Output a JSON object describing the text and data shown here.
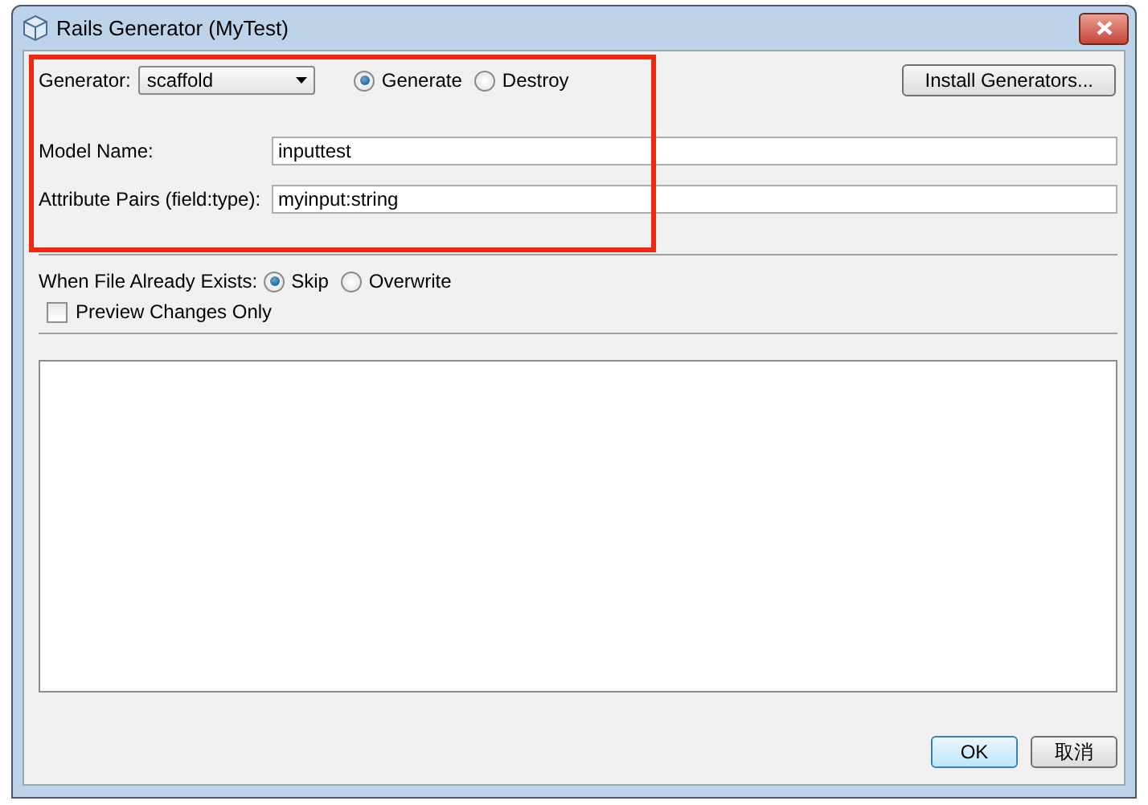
{
  "window": {
    "title": "Rails Generator (MyTest)"
  },
  "generator": {
    "label": "Generator:",
    "value": "scaffold"
  },
  "actions": [
    {
      "label": "Generate",
      "selected": true
    },
    {
      "label": "Destroy",
      "selected": false
    }
  ],
  "install_button": "Install Generators...",
  "model_name": {
    "label": "Model Name:",
    "value": "inputtest"
  },
  "attribute_pairs": {
    "label": "Attribute Pairs (field:type):",
    "value": "myinput:string"
  },
  "file_exists": {
    "label": "When File Already Exists:",
    "options": [
      {
        "label": "Skip",
        "selected": true
      },
      {
        "label": "Overwrite",
        "selected": false
      }
    ]
  },
  "preview_changes_only": {
    "label": "Preview Changes Only",
    "checked": false
  },
  "buttons": [
    {
      "label": "OK",
      "default": true
    },
    {
      "label": "取消",
      "default": false
    }
  ]
}
